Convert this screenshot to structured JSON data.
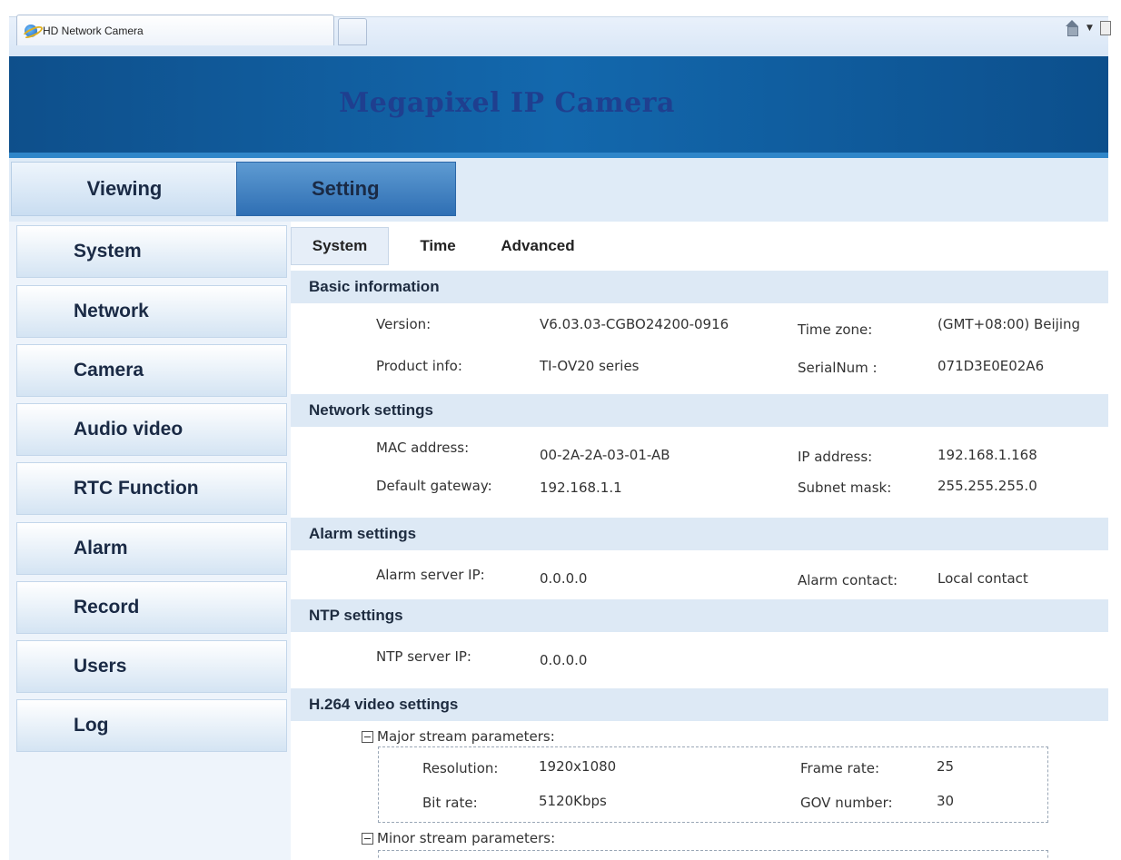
{
  "browser": {
    "tab_title": "HD Network Camera",
    "icons": [
      "ie-icon",
      "home-icon",
      "dropdown-icon",
      "page-icon"
    ]
  },
  "banner": {
    "title": "Megapixel IP Camera"
  },
  "main_tabs": [
    {
      "label": "Viewing",
      "active": false
    },
    {
      "label": "Setting",
      "active": true
    }
  ],
  "sidebar": {
    "items": [
      {
        "label": "System"
      },
      {
        "label": "Network"
      },
      {
        "label": "Camera"
      },
      {
        "label": "Audio video"
      },
      {
        "label": "RTC Function"
      },
      {
        "label": "Alarm"
      },
      {
        "label": "Record"
      },
      {
        "label": "Users"
      },
      {
        "label": "Log"
      }
    ]
  },
  "sub_tabs": [
    {
      "label": "System",
      "active": true
    },
    {
      "label": "Time",
      "active": false
    },
    {
      "label": "Advanced",
      "active": false
    }
  ],
  "sections": {
    "basic": {
      "title": "Basic information",
      "version_label": "Version:",
      "version_value": "V6.03.03-CGBO24200-0916",
      "timezone_label": "Time zone:",
      "timezone_value": "(GMT+08:00) Beijing",
      "product_label": "Product info:",
      "product_value": "TI-OV20 series",
      "serial_label": "SerialNum :",
      "serial_value": "071D3E0E02A6"
    },
    "network": {
      "title": "Network settings",
      "mac_label": "MAC address:",
      "mac_value": "00-2A-2A-03-01-AB",
      "ip_label": "IP address:",
      "ip_value": "192.168.1.168",
      "gateway_label": "Default gateway:",
      "gateway_value": "192.168.1.1",
      "subnet_label": "Subnet mask:",
      "subnet_value": "255.255.255.0"
    },
    "alarm": {
      "title": "Alarm settings",
      "server_label": "Alarm server IP:",
      "server_value": "0.0.0.0",
      "contact_label": "Alarm contact:",
      "contact_value": "Local contact"
    },
    "ntp": {
      "title": "NTP settings",
      "server_label": "NTP server IP:",
      "server_value": "0.0.0.0"
    },
    "h264": {
      "title": "H.264 video settings",
      "major": {
        "header": "Major stream parameters:",
        "resolution_label": "Resolution:",
        "resolution_value": "1920x1080",
        "framerate_label": "Frame rate:",
        "framerate_value": "25",
        "bitrate_label": "Bit rate:",
        "bitrate_value": "5120Kbps",
        "gov_label": "GOV number:",
        "gov_value": "30"
      },
      "minor": {
        "header": "Minor stream parameters:"
      }
    }
  },
  "colors": {
    "banner_bg": "#1368ad",
    "banner_title": "#1f3f8f",
    "active_tab": "#3d7fc2",
    "section_bar": "#dde9f5",
    "sidebar_bg": "#eef4fb"
  }
}
